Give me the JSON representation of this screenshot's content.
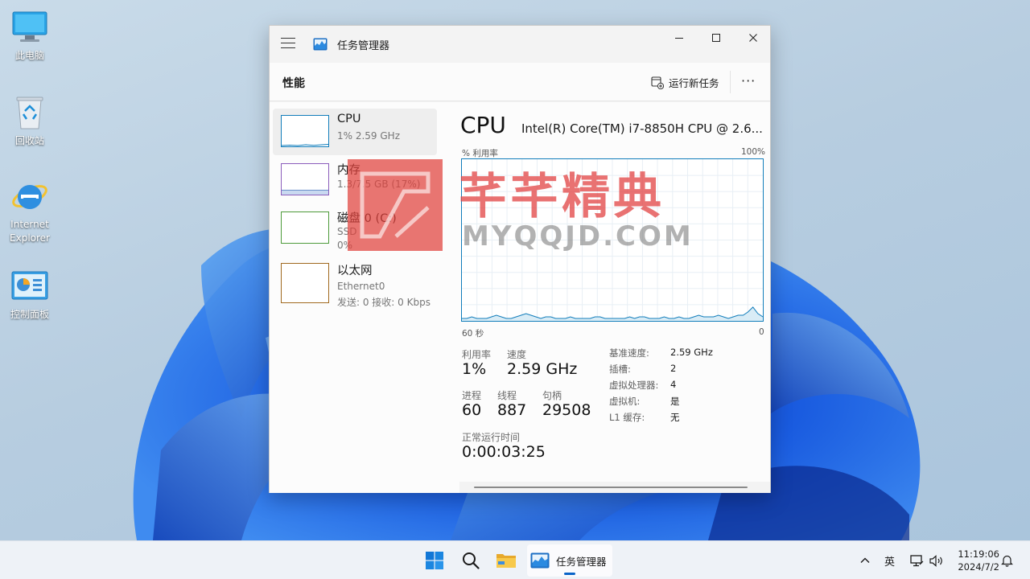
{
  "desktop": {
    "icons": [
      {
        "label": "此电脑",
        "icon": "computer-icon"
      },
      {
        "label": "回收站",
        "icon": "recycle-bin-icon"
      },
      {
        "label": "Internet\nExplorer",
        "icon": "internet-explorer-icon"
      },
      {
        "label": "控制面板",
        "icon": "control-panel-icon"
      }
    ]
  },
  "window": {
    "title": "任务管理器",
    "section_title": "性能",
    "run_new_task": "运行新任务",
    "more": "···"
  },
  "perf_list": [
    {
      "name": "CPU",
      "sub": [
        "1% 2.59 GHz"
      ],
      "selected": true
    },
    {
      "name": "内存",
      "sub": [
        "1.3/7.5 GB (17%)"
      ],
      "selected": false
    },
    {
      "name": "磁盘 0 (C:)",
      "sub": [
        "SSD",
        "0%"
      ],
      "selected": false
    },
    {
      "name": "以太网",
      "sub": [
        "Ethernet0",
        "发送: 0 接收: 0 Kbps"
      ],
      "selected": false
    }
  ],
  "details": {
    "title": "CPU",
    "model": "Intel(R) Core(TM) i7-8850H CPU @ 2.6...",
    "graph_top_left": "% 利用率",
    "graph_top_right": "100%",
    "graph_bottom_left": "60 秒",
    "graph_bottom_right": "0",
    "utilization_label": "利用率",
    "utilization_value": "1%",
    "speed_label": "速度",
    "speed_value": "2.59 GHz",
    "processes_label": "进程",
    "processes_value": "60",
    "threads_label": "线程",
    "threads_value": "887",
    "handles_label": "句柄",
    "handles_value": "29508",
    "uptime_label": "正常运行时间",
    "uptime_value": "0:00:03:25",
    "specs": [
      {
        "key": "基准速度:",
        "value": "2.59 GHz"
      },
      {
        "key": "插槽:",
        "value": "2"
      },
      {
        "key": "虚拟处理器:",
        "value": "4"
      },
      {
        "key": "虚拟机:",
        "value": "是"
      },
      {
        "key": "L1 缓存:",
        "value": "无"
      }
    ],
    "cpu_history_percent": [
      1,
      1,
      2,
      1,
      1,
      1,
      2,
      3,
      2,
      1,
      1,
      2,
      3,
      4,
      3,
      2,
      1,
      2,
      2,
      1,
      1,
      1,
      2,
      1,
      1,
      1,
      1,
      2,
      2,
      1,
      1,
      1,
      1,
      1,
      2,
      1,
      2,
      2,
      1,
      1,
      1,
      2,
      1,
      1,
      2,
      1,
      1,
      2,
      3,
      2,
      2,
      2,
      3,
      2,
      1,
      2,
      3,
      3,
      5,
      8,
      4,
      2
    ]
  },
  "watermark": {
    "cn": "芊芊精典",
    "en": "MYQQJD.COM"
  },
  "taskbar": {
    "app_label": "任务管理器",
    "ime": "英",
    "time": "11:19:06",
    "date": "2024/7/2"
  },
  "colors": {
    "accent": "#117dbb",
    "graph_fill": "#d9ecf6",
    "watermark_red": "#e0413c"
  }
}
